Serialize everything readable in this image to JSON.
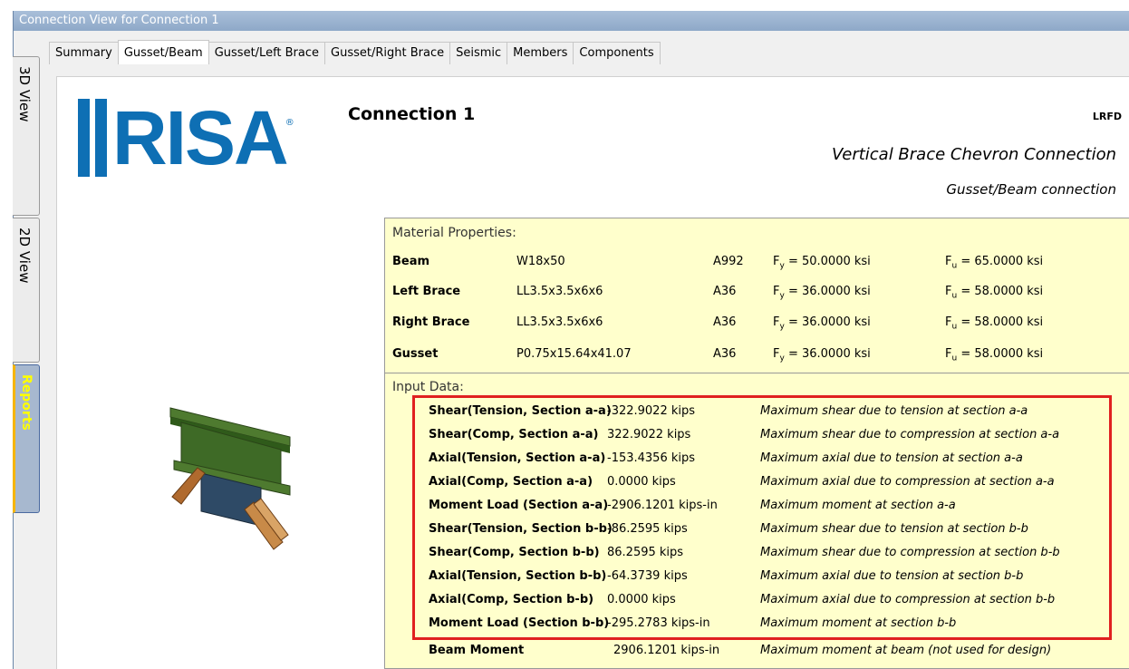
{
  "window": {
    "title": "Connection View for Connection 1"
  },
  "tabs": [
    "Summary",
    "Gusset/Beam",
    "Gusset/Left Brace",
    "Gusset/Right Brace",
    "Seismic",
    "Members",
    "Components"
  ],
  "side_tabs": {
    "view3d": "3D View",
    "view2d": "2D View",
    "reports": "Reports"
  },
  "report": {
    "logo_text": "RISA",
    "title": "Connection 1",
    "code": "LRFD",
    "subtitle1": "Vertical Brace Chevron Connection",
    "subtitle2": "Gusset/Beam connection",
    "material_header": "Material Properties:",
    "materials": [
      {
        "name": "Beam",
        "section": "W18x50",
        "grade": "A992",
        "fy": "= 50.0000 ksi",
        "fu": "= 65.0000 ksi"
      },
      {
        "name": "Left Brace",
        "section": "LL3.5x3.5x6x6",
        "grade": "A36",
        "fy": "= 36.0000 ksi",
        "fu": "= 58.0000 ksi"
      },
      {
        "name": "Right Brace",
        "section": "LL3.5x3.5x6x6",
        "grade": "A36",
        "fy": "= 36.0000 ksi",
        "fu": "= 58.0000 ksi"
      },
      {
        "name": "Gusset",
        "section": "P0.75x15.64x41.07",
        "grade": "A36",
        "fy": "= 36.0000 ksi",
        "fu": "= 58.0000 ksi"
      }
    ],
    "input_header": "Input Data:",
    "inputs": [
      {
        "label": "Shear(Tension, Section a-a)",
        "value": "-322.9022 kips",
        "desc": "Maximum shear due to tension at section a-a"
      },
      {
        "label": "Shear(Comp, Section a-a)",
        "value": "322.9022 kips",
        "desc": "Maximum shear due to compression at section a-a"
      },
      {
        "label": "Axial(Tension, Section a-a)",
        "value": "-153.4356 kips",
        "desc": "Maximum axial due to tension at section a-a"
      },
      {
        "label": "Axial(Comp, Section a-a)",
        "value": "0.0000 kips",
        "desc": "Maximum axial due to compression at section a-a"
      },
      {
        "label": "Moment Load (Section a-a)",
        "value": "-2906.1201 kips-in",
        "desc": "Maximum moment at section a-a"
      },
      {
        "label": "Shear(Tension, Section b-b)",
        "value": "-86.2595 kips",
        "desc": "Maximum shear due to tension at section b-b"
      },
      {
        "label": "Shear(Comp, Section b-b)",
        "value": "86.2595 kips",
        "desc": "Maximum shear due to compression at section b-b"
      },
      {
        "label": "Axial(Tension, Section b-b)",
        "value": "-64.3739 kips",
        "desc": "Maximum axial due to tension at section b-b"
      },
      {
        "label": "Axial(Comp, Section b-b)",
        "value": "0.0000 kips",
        "desc": "Maximum axial due to compression at section b-b"
      },
      {
        "label": "Moment Load (Section b-b)",
        "value": "-295.2783 kips-in",
        "desc": "Maximum moment at section b-b"
      },
      {
        "label": "Beam Moment",
        "value": "2906.1201 kips-in",
        "desc": "Maximum moment at beam (not used for design)"
      }
    ]
  },
  "colors": {
    "brand": "#0e6fb4",
    "panel": "#ffffcc",
    "highlight": "#e02020"
  }
}
